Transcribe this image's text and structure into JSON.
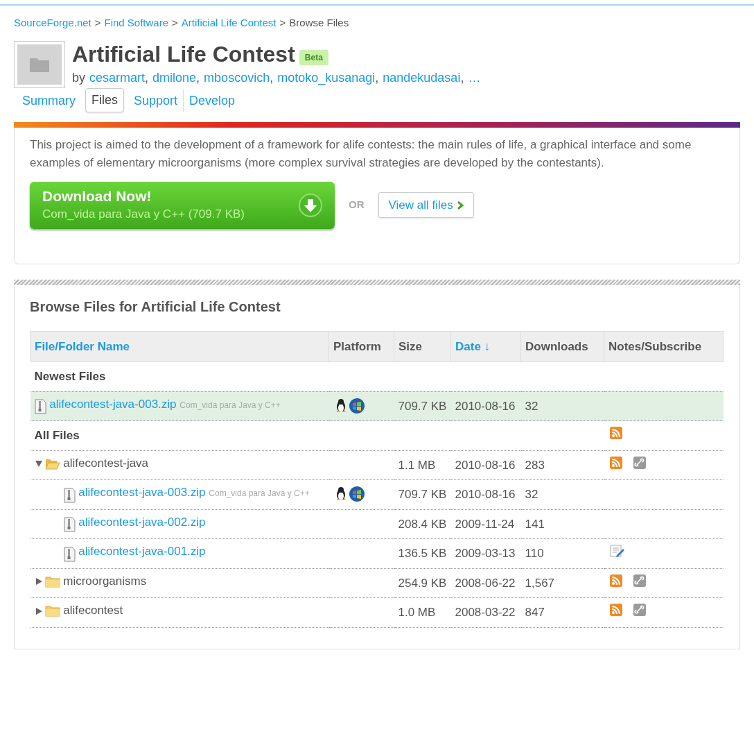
{
  "breadcrumb": {
    "links": [
      "SourceForge.net",
      "Find Software",
      "Artificial Life Contest"
    ],
    "separator": ">",
    "current": "Browse Files"
  },
  "project": {
    "title": "Artificial Life Contest",
    "badge": "Beta",
    "by": "by",
    "developers": [
      "cesarmart",
      "dmilone",
      "mboscovich",
      "motoko_kusanagi",
      "nandekudasai"
    ],
    "developer_separator": ",",
    "more": "…"
  },
  "tabs": [
    {
      "label": "Summary",
      "selected": false
    },
    {
      "label": "Files",
      "selected": true
    },
    {
      "label": "Support",
      "selected": false
    },
    {
      "label": "Develop",
      "selected": false
    }
  ],
  "description": "This project is aimed to the development of a framework for alife contests: the main rules of life, a graphical interface and some examples of elementary microorganisms (more complex survival strategies are developed by the contestants).",
  "download": {
    "title": "Download Now!",
    "subtitle": "Com_vida para Java y C++ (709.7 KB)",
    "or": "OR",
    "view_all": "View all files"
  },
  "browse": {
    "title": "Browse Files for Artificial Life Contest",
    "columns": [
      {
        "label": "File/Folder Name",
        "sortable": true
      },
      {
        "label": "Platform",
        "sortable": false
      },
      {
        "label": "Size",
        "sortable": false
      },
      {
        "label": "Date ↓",
        "sortable": true
      },
      {
        "label": "Downloads",
        "sortable": false
      },
      {
        "label": "Notes/Subscribe",
        "sortable": false
      }
    ],
    "rows": [
      {
        "kind": "section",
        "label": "Newest Files",
        "feed": false
      },
      {
        "kind": "file",
        "name": "alifecontest-java-003.zip",
        "note": "Com_vida para Java y C++",
        "linux": true,
        "windows": true,
        "size": "709.7 KB",
        "date": "2010-08-16",
        "downloads": "32",
        "has_notes": false,
        "highlighted": true
      },
      {
        "kind": "section",
        "label": "All Files",
        "feed": true
      },
      {
        "kind": "folder",
        "name": "alifecontest-java",
        "expanded": true,
        "size": "1.1 MB",
        "date": "2010-08-16",
        "downloads": "283",
        "feed": true,
        "link": true,
        "children": [
          {
            "kind": "file",
            "name": "alifecontest-java-003.zip",
            "note": "Com_vida para Java y C++",
            "linux": true,
            "windows": true,
            "size": "709.7 KB",
            "date": "2010-08-16",
            "downloads": "32",
            "has_notes": false,
            "highlighted": false
          },
          {
            "kind": "file",
            "name": "alifecontest-java-002.zip",
            "linux": false,
            "windows": false,
            "size": "208.4 KB",
            "date": "2009-11-24",
            "downloads": "141",
            "has_notes": false,
            "highlighted": false
          },
          {
            "kind": "file",
            "name": "alifecontest-java-001.zip",
            "linux": false,
            "windows": false,
            "size": "136.5 KB",
            "date": "2009-03-13",
            "downloads": "110",
            "has_notes": true,
            "highlighted": false
          }
        ]
      },
      {
        "kind": "folder",
        "name": "microorganisms",
        "expanded": false,
        "size": "254.9 KB",
        "date": "2008-06-22",
        "downloads": "1,567",
        "feed": true,
        "link": true
      },
      {
        "kind": "folder",
        "name": "alifecontest",
        "expanded": false,
        "size": "1.0 MB",
        "date": "2008-03-22",
        "downloads": "847",
        "feed": true,
        "link": true
      }
    ]
  }
}
